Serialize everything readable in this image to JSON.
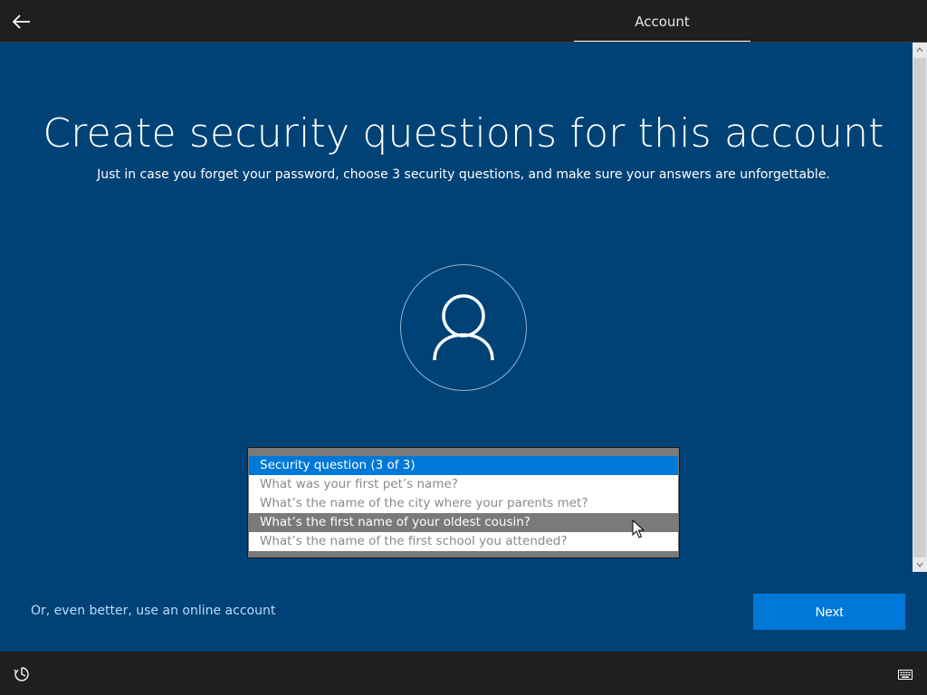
{
  "header": {
    "back_icon": "arrow-left-icon",
    "tab_label": "Account"
  },
  "main": {
    "title": "Create security questions for this account",
    "subtitle": "Just in case you forget your password, choose 3 security questions, and make sure your answers are unforgettable.",
    "avatar_icon": "user-icon"
  },
  "dropdown": {
    "options": [
      {
        "label": "Security question (3 of 3)",
        "state": "selected"
      },
      {
        "label": "What was your first pet’s name?",
        "state": "disabled"
      },
      {
        "label": "What’s the name of the city where your parents met?",
        "state": "disabled"
      },
      {
        "label": "What’s the first name of your oldest cousin?",
        "state": "hover"
      },
      {
        "label": "What’s the name of the first school you attended?",
        "state": "disabled"
      }
    ]
  },
  "footer": {
    "online_account_link": "Or, even better, use an online account",
    "next_label": "Next"
  },
  "bottom": {
    "ease_of_access_icon": "ease-of-access-icon",
    "keyboard_icon": "keyboard-icon"
  },
  "colors": {
    "background": "#004275",
    "accent": "#0078d7",
    "bar": "#1f1f1f",
    "link": "#b9dcff"
  }
}
